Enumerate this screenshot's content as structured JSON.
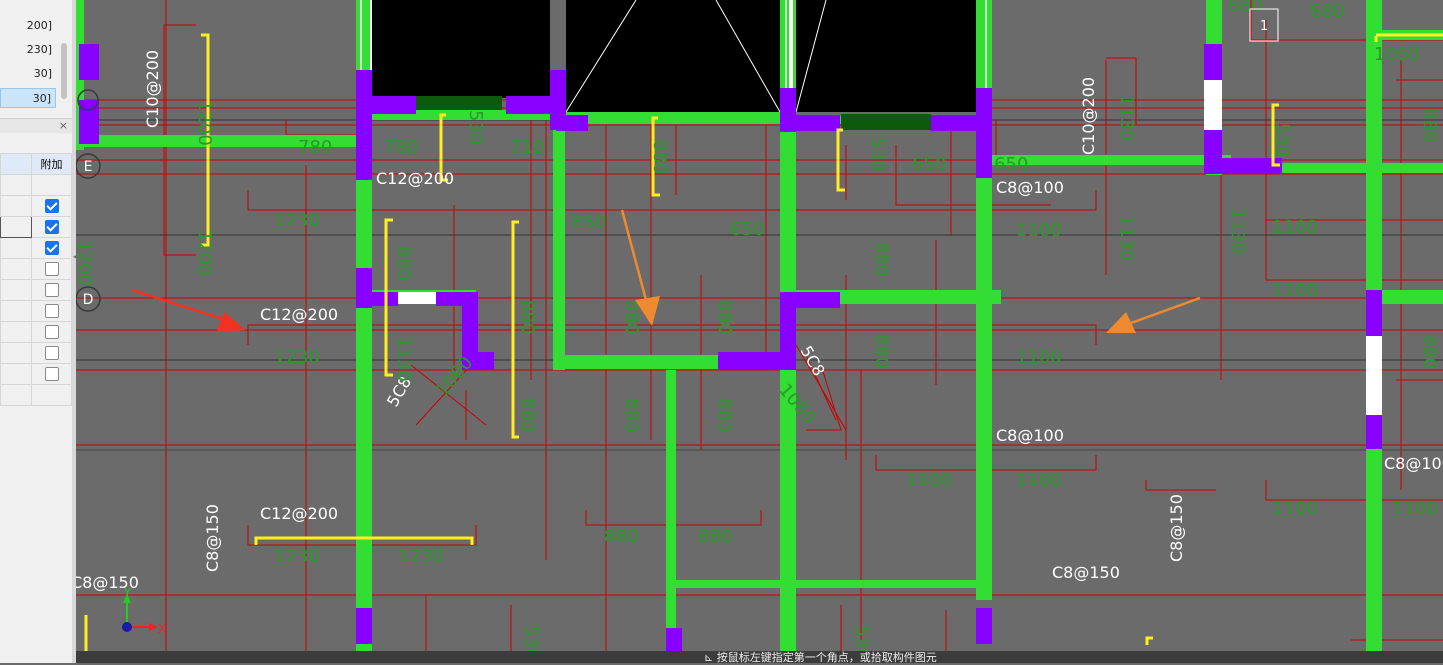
{
  "layers_panel": {
    "items": [
      {
        "label": "200]",
        "selected": false
      },
      {
        "label": "230]",
        "selected": false
      },
      {
        "label": "30]",
        "selected": false
      },
      {
        "label": "30]",
        "selected": true
      }
    ]
  },
  "attributes_panel": {
    "close_icon": "×",
    "column_header": "附加",
    "checkboxes": [
      true,
      true,
      true,
      false,
      false,
      false,
      false,
      false,
      false
    ]
  },
  "grid_axes": {
    "E": "E",
    "D": "D"
  },
  "labels": {
    "C10_200": "C10@200",
    "C12_200": "C12@200",
    "C8_100": "C8@100",
    "C8_150": "C8@150",
    "5C8": "5C8",
    "v1200": "1200",
    "v780": "780",
    "v710": "710",
    "v650": "650",
    "v1230": "1230",
    "v1100": "1100",
    "v880": "880",
    "v1060": "1060",
    "v1130": "1130",
    "v1050": "1050",
    "v680": "680",
    "v530": "530",
    "v1": "1"
  },
  "ucs": {
    "x_label": "X",
    "y_label": "Y"
  },
  "colors": {
    "background": "#6b6b6b",
    "wall": "#33dd33",
    "column": "#8800ff",
    "rebar_line": "#cc0000",
    "dim_text": "#2a9a2a",
    "yellow_rebar": "#ffee22",
    "arrow_red": "#ee3322",
    "arrow_orange": "#f08a30"
  },
  "status_bar": {
    "text": "⊾ 按鼠标左键指定第一个角点，或拾取构件图元"
  }
}
